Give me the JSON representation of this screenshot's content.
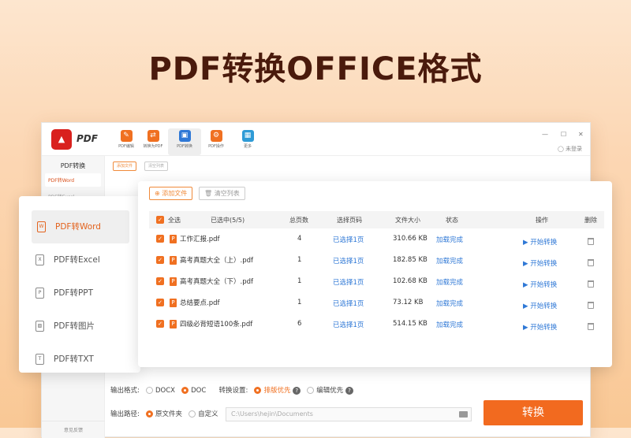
{
  "headline": "PDF转换OFFICE格式",
  "app": {
    "logo_text": "PDF",
    "toolbar": [
      {
        "label": "PDF编辑",
        "color": "#f07021"
      },
      {
        "label": "转换为PDF",
        "color": "#f07021"
      },
      {
        "label": "PDF转换",
        "color": "#2f78d6"
      },
      {
        "label": "PDF操作",
        "color": "#f07021"
      },
      {
        "label": "更多",
        "color": "#2f9bd6"
      }
    ],
    "login": "未登录",
    "sidebar_title": "PDF转换",
    "sidebar_items": [
      "PDF转Word",
      "PDF转Excel"
    ],
    "feedback": "意见反馈",
    "mini_add": "添加文件",
    "mini_clear": "清空列表"
  },
  "float_list": {
    "items": [
      "PDF转Word",
      "PDF转Excel",
      "PDF转PPT",
      "PDF转图片",
      "PDF转TXT"
    ],
    "icons": [
      "W",
      "X",
      "P",
      "▨",
      "T"
    ]
  },
  "panel": {
    "add_button": "添加文件",
    "clear_button": "清空列表",
    "headers": {
      "select_all": "全选",
      "selected": "已选中(5/5)",
      "pages": "总页数",
      "page_select": "选择页码",
      "size": "文件大小",
      "status": "状态",
      "action": "操作",
      "delete": "删除"
    },
    "rows": [
      {
        "name": "工作汇报.pdf",
        "pages": "4",
        "page_select": "已选择1页",
        "size": "310.66 KB",
        "status": "加载完成",
        "action": "开始转换"
      },
      {
        "name": "高考真题大全（上）.pdf",
        "pages": "1",
        "page_select": "已选择1页",
        "size": "182.85 KB",
        "status": "加载完成",
        "action": "开始转换"
      },
      {
        "name": "高考真题大全（下）.pdf",
        "pages": "1",
        "page_select": "已选择1页",
        "size": "102.68 KB",
        "status": "加载完成",
        "action": "开始转换"
      },
      {
        "name": "总结要点.pdf",
        "pages": "1",
        "page_select": "已选择1页",
        "size": "73.12 KB",
        "status": "加载完成",
        "action": "开始转换"
      },
      {
        "name": "四级必背短语100条.pdf",
        "pages": "6",
        "page_select": "已选择1页",
        "size": "514.15 KB",
        "status": "加载完成",
        "action": "开始转换"
      }
    ]
  },
  "options": {
    "format_label": "输出格式:",
    "format_docx": "DOCX",
    "format_doc": "DOC",
    "convert_setting_label": "转换设置:",
    "layout_first": "排版优先",
    "edit_first": "编辑优先",
    "path_label": "输出路径:",
    "path_original": "原文件夹",
    "path_custom": "自定义",
    "path_value": "C:\\Users\\hejin\\Documents",
    "convert_button": "转换"
  }
}
